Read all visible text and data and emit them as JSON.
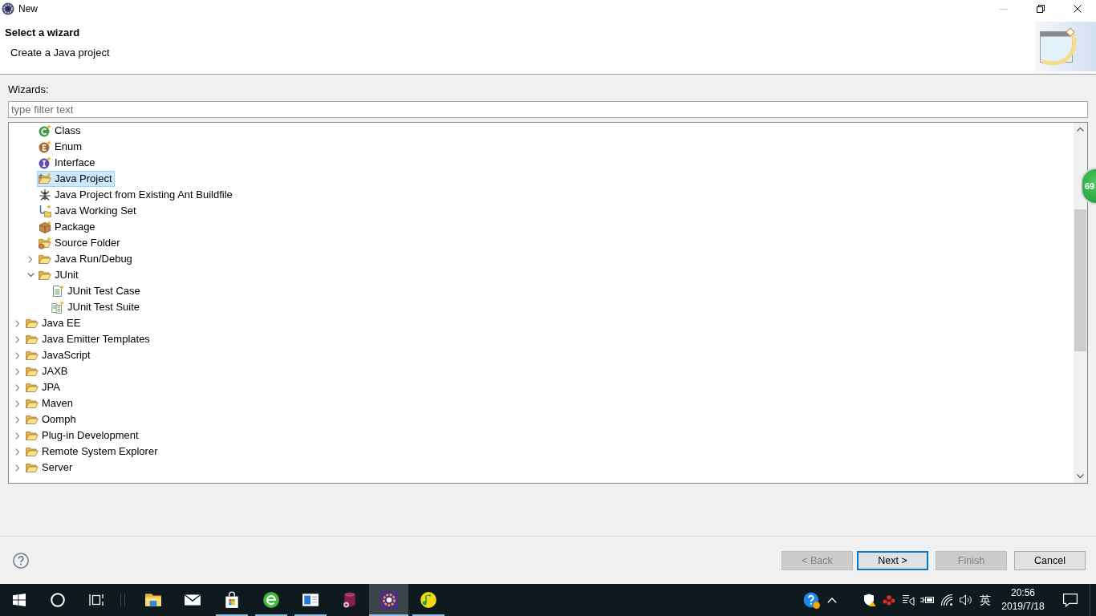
{
  "window": {
    "title": "New",
    "buttons": [
      {
        "kind": "minimize",
        "disabled": true
      },
      {
        "kind": "restore",
        "disabled": false
      },
      {
        "kind": "close",
        "disabled": false
      }
    ]
  },
  "header": {
    "title": "Select a wizard",
    "description": "Create a Java project"
  },
  "filter": {
    "label": "Wizards:",
    "placeholder": "type filter text"
  },
  "tree": {
    "items": [
      {
        "children": [
          {
            "kind": "class",
            "label": "Class",
            "selected": false
          },
          {
            "kind": "enum",
            "label": "Enum",
            "selected": false
          },
          {
            "kind": "interface",
            "label": "Interface",
            "selected": false
          },
          {
            "kind": "project",
            "label": "Java Project",
            "selected": true
          },
          {
            "kind": "ant",
            "label": "Java Project from Existing Ant Buildfile",
            "selected": false
          },
          {
            "kind": "working_set",
            "label": "Java Working Set",
            "selected": false
          },
          {
            "kind": "package",
            "label": "Package",
            "selected": false
          },
          {
            "kind": "source_folder",
            "label": "Source Folder",
            "selected": false
          },
          {
            "kind": "folder",
            "label": "Java Run/Debug",
            "expanded": false,
            "selected": false
          },
          {
            "kind": "folder",
            "label": "JUnit",
            "expanded": true,
            "selected": false,
            "children": [
              {
                "kind": "test_case",
                "label": "JUnit Test Case",
                "selected": false
              },
              {
                "kind": "test_suite",
                "label": "JUnit Test Suite",
                "selected": false
              }
            ]
          }
        ]
      },
      {
        "kind": "folder",
        "label": "Java EE",
        "expanded": false,
        "selected": false
      },
      {
        "kind": "folder",
        "label": "Java Emitter Templates",
        "expanded": false,
        "selected": false
      },
      {
        "kind": "folder",
        "label": "JavaScript",
        "expanded": false,
        "selected": false
      },
      {
        "kind": "folder",
        "label": "JAXB",
        "expanded": false,
        "selected": false
      },
      {
        "kind": "folder",
        "label": "JPA",
        "expanded": false,
        "selected": false
      },
      {
        "kind": "folder",
        "label": "Maven",
        "expanded": false,
        "selected": false
      },
      {
        "kind": "folder",
        "label": "Oomph",
        "expanded": false,
        "selected": false
      },
      {
        "kind": "folder",
        "label": "Plug-in Development",
        "expanded": false,
        "selected": false
      },
      {
        "kind": "folder",
        "label": "Remote System Explorer",
        "expanded": false,
        "selected": false
      },
      {
        "kind": "folder",
        "label": "Server",
        "expanded": false,
        "selected": false
      }
    ]
  },
  "buttons": [
    {
      "label": "< Back",
      "disabled": true,
      "default": false
    },
    {
      "label": "Next >",
      "disabled": false,
      "default": true
    },
    {
      "label": "Finish",
      "disabled": true,
      "default": false
    },
    {
      "label": "Cancel",
      "disabled": false,
      "default": false
    }
  ],
  "floating_ball": {
    "text": "69"
  },
  "taskbar": {
    "apps": [
      {
        "kind": "explorer",
        "running": false,
        "active": false
      },
      {
        "kind": "mail",
        "running": false,
        "active": false
      },
      {
        "kind": "store",
        "running": true,
        "active": false
      },
      {
        "kind": "browser",
        "running": true,
        "active": false
      },
      {
        "kind": "window",
        "running": true,
        "active": false
      },
      {
        "kind": "database",
        "running": false,
        "active": false
      },
      {
        "kind": "ide",
        "running": true,
        "active": true
      },
      {
        "kind": "music",
        "running": true,
        "active": false
      }
    ],
    "input_method": "英",
    "time": "20:56",
    "date": "2019/7/18"
  }
}
